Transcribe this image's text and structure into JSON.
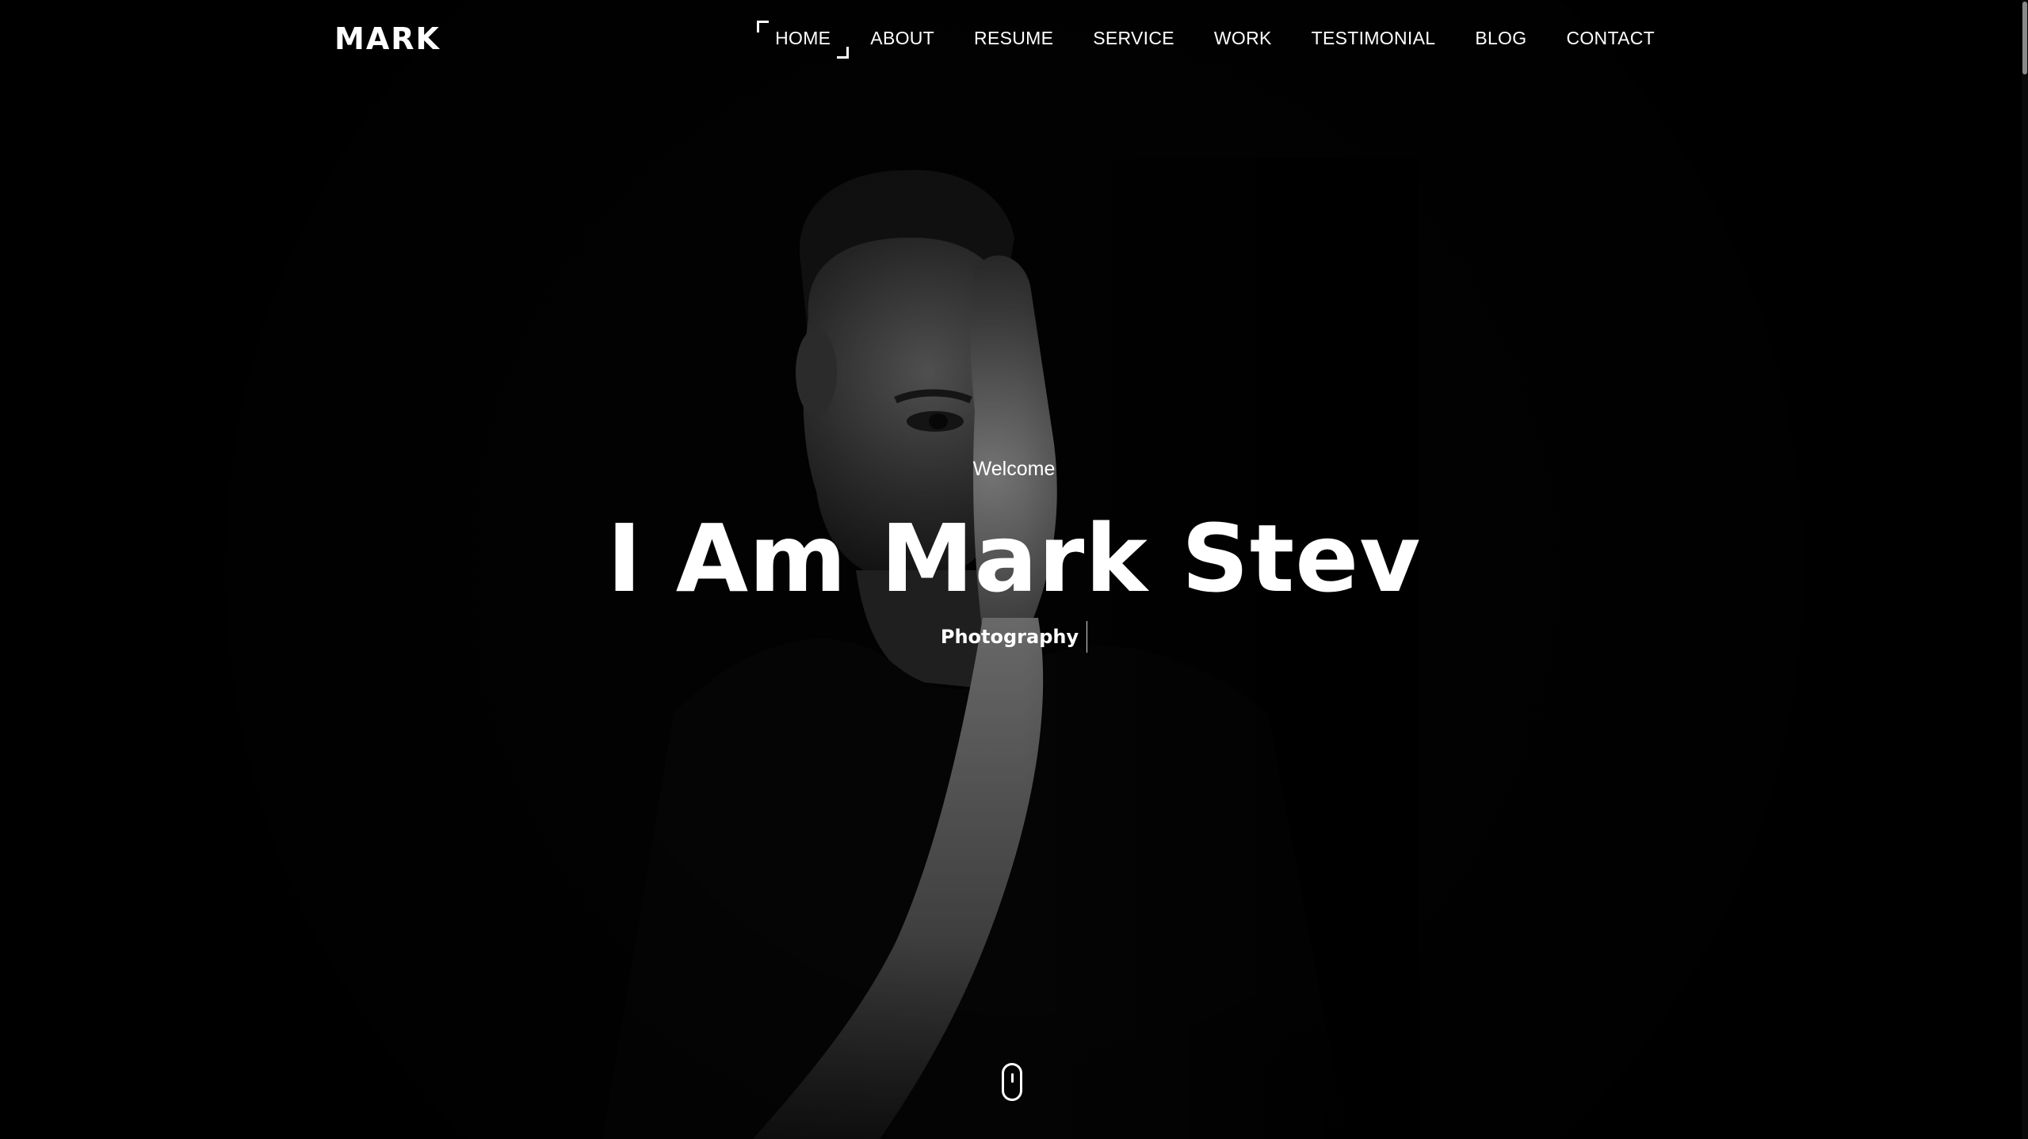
{
  "header": {
    "logo": "MARK",
    "nav": [
      {
        "label": "HOME",
        "active": true
      },
      {
        "label": "ABOUT",
        "active": false
      },
      {
        "label": "RESUME",
        "active": false
      },
      {
        "label": "SERVICE",
        "active": false
      },
      {
        "label": "WORK",
        "active": false
      },
      {
        "label": "TESTIMONIAL",
        "active": false
      },
      {
        "label": "BLOG",
        "active": false
      },
      {
        "label": "CONTACT",
        "active": false
      }
    ]
  },
  "hero": {
    "welcome": "Welcome",
    "headline": "I Am Mark Stev",
    "subtitle": "Photography",
    "background_image": "portrait-photo",
    "scroll_icon": "mouse-scroll-icon"
  },
  "colors": {
    "background": "#000000",
    "text": "#ffffff",
    "accent": "#ffffff"
  }
}
